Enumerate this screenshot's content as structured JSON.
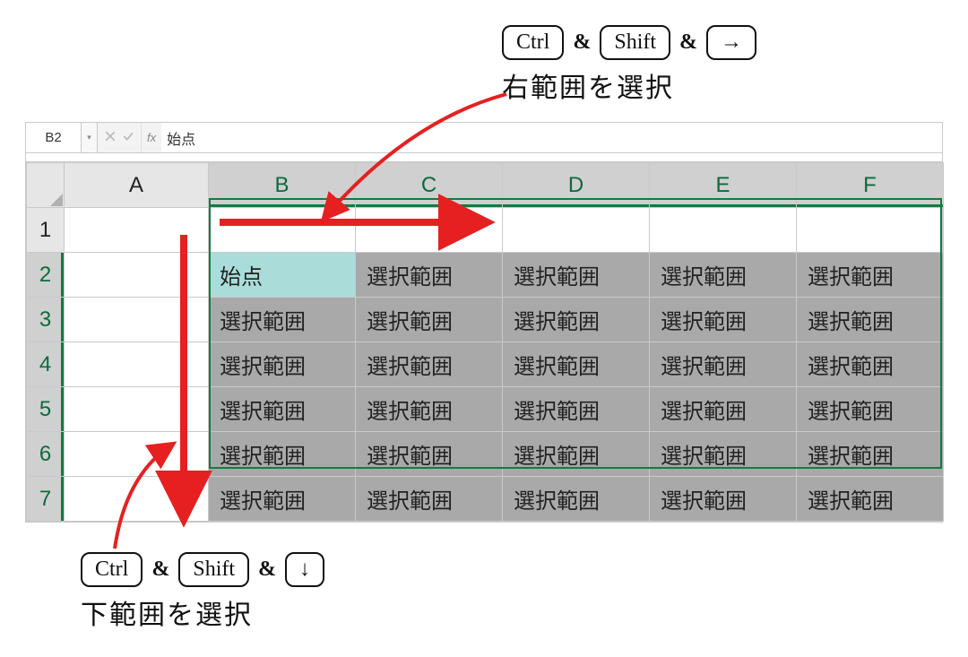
{
  "shortcut_top": {
    "key1": "Ctrl",
    "amp1": "&",
    "key2": "Shift",
    "amp2": "&",
    "key3": "→",
    "caption": "右範囲を選択"
  },
  "shortcut_bottom": {
    "key1": "Ctrl",
    "amp1": "&",
    "key2": "Shift",
    "amp2": "&",
    "key3": "↓",
    "caption": "下範囲を選択"
  },
  "spreadsheet": {
    "namebox": "B2",
    "fx_label": "fx",
    "formula": "始点",
    "columns": [
      "A",
      "B",
      "C",
      "D",
      "E",
      "F"
    ],
    "rows": [
      "1",
      "2",
      "3",
      "4",
      "5",
      "6",
      "7"
    ],
    "active_cell_text": "始点",
    "selected_cell_text": "選択範囲"
  },
  "chart_data": {
    "type": "table",
    "active_cell": "B2",
    "selection": "B2:F7",
    "columns": [
      "A",
      "B",
      "C",
      "D",
      "E",
      "F"
    ],
    "rows": [
      1,
      2,
      3,
      4,
      5,
      6,
      7
    ],
    "cells": {
      "B2": "始点",
      "C2": "選択範囲",
      "D2": "選択範囲",
      "E2": "選択範囲",
      "F2": "選択範囲",
      "B3": "選択範囲",
      "C3": "選択範囲",
      "D3": "選択範囲",
      "E3": "選択範囲",
      "F3": "選択範囲",
      "B4": "選択範囲",
      "C4": "選択範囲",
      "D4": "選択範囲",
      "E4": "選択範囲",
      "F4": "選択範囲",
      "B5": "選択範囲",
      "C5": "選択範囲",
      "D5": "選択範囲",
      "E5": "選択範囲",
      "F5": "選択範囲",
      "B6": "選択範囲",
      "C6": "選択範囲",
      "D6": "選択範囲",
      "E6": "選択範囲",
      "F6": "選択範囲",
      "B7": "選択範囲",
      "C7": "選択範囲",
      "D7": "選択範囲",
      "E7": "選択範囲",
      "F7": "選択範囲"
    }
  },
  "colors": {
    "arrow": "#e62020",
    "excel_green": "#107c41"
  }
}
